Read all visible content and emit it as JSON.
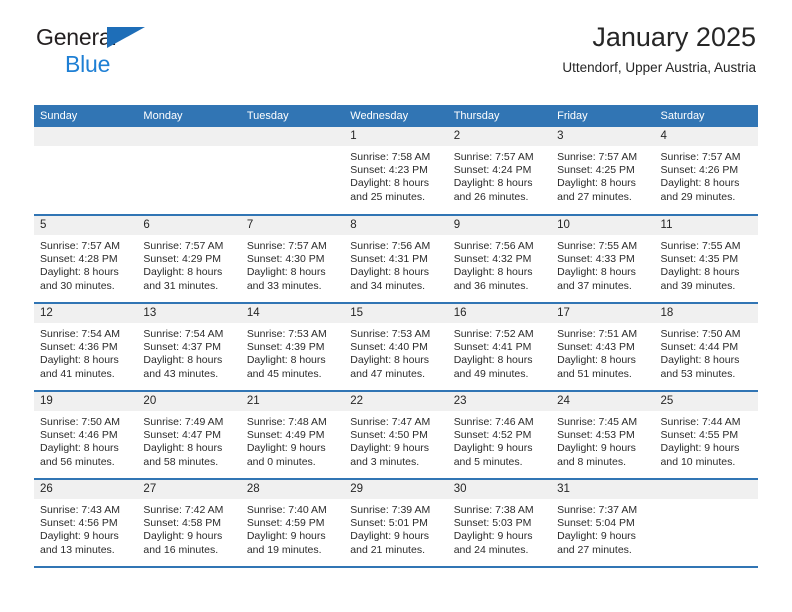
{
  "brand": {
    "line1": "General",
    "line2": "Blue",
    "triangle_color": "#1e6eb8",
    "line2_color": "#1e7fd4"
  },
  "header": {
    "title": "January 2025",
    "subtitle": "Uttendorf, Upper Austria, Austria"
  },
  "theme": {
    "header_bg": "#3175b4",
    "header_text": "#ffffff",
    "daynum_bg": "#f0f0f0",
    "cell_bg": "#ffffff",
    "separator": "#3175b4"
  },
  "calendar": {
    "weekday_headers": [
      "Sunday",
      "Monday",
      "Tuesday",
      "Wednesday",
      "Thursday",
      "Friday",
      "Saturday"
    ],
    "labels": {
      "sunrise_prefix": "Sunrise: ",
      "sunset_prefix": "Sunset: ",
      "daylight_prefix": "Daylight: "
    },
    "weeks": [
      [
        {
          "empty": true
        },
        {
          "empty": true
        },
        {
          "empty": true
        },
        {
          "day": "1",
          "sunrise": "Sunrise: 7:58 AM",
          "sunset": "Sunset: 4:23 PM",
          "daylight": "Daylight: 8 hours and 25 minutes."
        },
        {
          "day": "2",
          "sunrise": "Sunrise: 7:57 AM",
          "sunset": "Sunset: 4:24 PM",
          "daylight": "Daylight: 8 hours and 26 minutes."
        },
        {
          "day": "3",
          "sunrise": "Sunrise: 7:57 AM",
          "sunset": "Sunset: 4:25 PM",
          "daylight": "Daylight: 8 hours and 27 minutes."
        },
        {
          "day": "4",
          "sunrise": "Sunrise: 7:57 AM",
          "sunset": "Sunset: 4:26 PM",
          "daylight": "Daylight: 8 hours and 29 minutes."
        }
      ],
      [
        {
          "day": "5",
          "sunrise": "Sunrise: 7:57 AM",
          "sunset": "Sunset: 4:28 PM",
          "daylight": "Daylight: 8 hours and 30 minutes."
        },
        {
          "day": "6",
          "sunrise": "Sunrise: 7:57 AM",
          "sunset": "Sunset: 4:29 PM",
          "daylight": "Daylight: 8 hours and 31 minutes."
        },
        {
          "day": "7",
          "sunrise": "Sunrise: 7:57 AM",
          "sunset": "Sunset: 4:30 PM",
          "daylight": "Daylight: 8 hours and 33 minutes."
        },
        {
          "day": "8",
          "sunrise": "Sunrise: 7:56 AM",
          "sunset": "Sunset: 4:31 PM",
          "daylight": "Daylight: 8 hours and 34 minutes."
        },
        {
          "day": "9",
          "sunrise": "Sunrise: 7:56 AM",
          "sunset": "Sunset: 4:32 PM",
          "daylight": "Daylight: 8 hours and 36 minutes."
        },
        {
          "day": "10",
          "sunrise": "Sunrise: 7:55 AM",
          "sunset": "Sunset: 4:33 PM",
          "daylight": "Daylight: 8 hours and 37 minutes."
        },
        {
          "day": "11",
          "sunrise": "Sunrise: 7:55 AM",
          "sunset": "Sunset: 4:35 PM",
          "daylight": "Daylight: 8 hours and 39 minutes."
        }
      ],
      [
        {
          "day": "12",
          "sunrise": "Sunrise: 7:54 AM",
          "sunset": "Sunset: 4:36 PM",
          "daylight": "Daylight: 8 hours and 41 minutes."
        },
        {
          "day": "13",
          "sunrise": "Sunrise: 7:54 AM",
          "sunset": "Sunset: 4:37 PM",
          "daylight": "Daylight: 8 hours and 43 minutes."
        },
        {
          "day": "14",
          "sunrise": "Sunrise: 7:53 AM",
          "sunset": "Sunset: 4:39 PM",
          "daylight": "Daylight: 8 hours and 45 minutes."
        },
        {
          "day": "15",
          "sunrise": "Sunrise: 7:53 AM",
          "sunset": "Sunset: 4:40 PM",
          "daylight": "Daylight: 8 hours and 47 minutes."
        },
        {
          "day": "16",
          "sunrise": "Sunrise: 7:52 AM",
          "sunset": "Sunset: 4:41 PM",
          "daylight": "Daylight: 8 hours and 49 minutes."
        },
        {
          "day": "17",
          "sunrise": "Sunrise: 7:51 AM",
          "sunset": "Sunset: 4:43 PM",
          "daylight": "Daylight: 8 hours and 51 minutes."
        },
        {
          "day": "18",
          "sunrise": "Sunrise: 7:50 AM",
          "sunset": "Sunset: 4:44 PM",
          "daylight": "Daylight: 8 hours and 53 minutes."
        }
      ],
      [
        {
          "day": "19",
          "sunrise": "Sunrise: 7:50 AM",
          "sunset": "Sunset: 4:46 PM",
          "daylight": "Daylight: 8 hours and 56 minutes."
        },
        {
          "day": "20",
          "sunrise": "Sunrise: 7:49 AM",
          "sunset": "Sunset: 4:47 PM",
          "daylight": "Daylight: 8 hours and 58 minutes."
        },
        {
          "day": "21",
          "sunrise": "Sunrise: 7:48 AM",
          "sunset": "Sunset: 4:49 PM",
          "daylight": "Daylight: 9 hours and 0 minutes."
        },
        {
          "day": "22",
          "sunrise": "Sunrise: 7:47 AM",
          "sunset": "Sunset: 4:50 PM",
          "daylight": "Daylight: 9 hours and 3 minutes."
        },
        {
          "day": "23",
          "sunrise": "Sunrise: 7:46 AM",
          "sunset": "Sunset: 4:52 PM",
          "daylight": "Daylight: 9 hours and 5 minutes."
        },
        {
          "day": "24",
          "sunrise": "Sunrise: 7:45 AM",
          "sunset": "Sunset: 4:53 PM",
          "daylight": "Daylight: 9 hours and 8 minutes."
        },
        {
          "day": "25",
          "sunrise": "Sunrise: 7:44 AM",
          "sunset": "Sunset: 4:55 PM",
          "daylight": "Daylight: 9 hours and 10 minutes."
        }
      ],
      [
        {
          "day": "26",
          "sunrise": "Sunrise: 7:43 AM",
          "sunset": "Sunset: 4:56 PM",
          "daylight": "Daylight: 9 hours and 13 minutes."
        },
        {
          "day": "27",
          "sunrise": "Sunrise: 7:42 AM",
          "sunset": "Sunset: 4:58 PM",
          "daylight": "Daylight: 9 hours and 16 minutes."
        },
        {
          "day": "28",
          "sunrise": "Sunrise: 7:40 AM",
          "sunset": "Sunset: 4:59 PM",
          "daylight": "Daylight: 9 hours and 19 minutes."
        },
        {
          "day": "29",
          "sunrise": "Sunrise: 7:39 AM",
          "sunset": "Sunset: 5:01 PM",
          "daylight": "Daylight: 9 hours and 21 minutes."
        },
        {
          "day": "30",
          "sunrise": "Sunrise: 7:38 AM",
          "sunset": "Sunset: 5:03 PM",
          "daylight": "Daylight: 9 hours and 24 minutes."
        },
        {
          "day": "31",
          "sunrise": "Sunrise: 7:37 AM",
          "sunset": "Sunset: 5:04 PM",
          "daylight": "Daylight: 9 hours and 27 minutes."
        },
        {
          "empty": true
        }
      ]
    ]
  }
}
